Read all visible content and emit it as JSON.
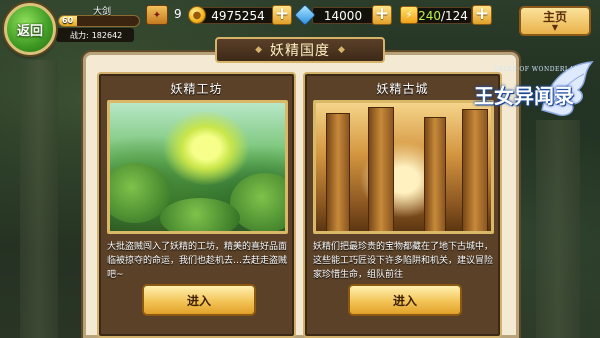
{
  "header": {
    "back_label": "返回",
    "player_name": "大剑",
    "level": "60",
    "power_label": "战力:",
    "power_value": "182642",
    "rank_value": "9",
    "gold": "4975254",
    "diamonds": "14000",
    "energy_current": "240",
    "energy_max": "/124",
    "main_menu_label": "主页",
    "level_progress": 0.22
  },
  "panel": {
    "title": "妖精国度",
    "cards": [
      {
        "title": "妖精工坊",
        "description": "大批盗贼闯入了妖精的工坊，精美的喜好品面临被掠夺的命运，我们也趁机去…去赶走盗贼吧~",
        "enter_label": "进入"
      },
      {
        "title": "妖精古城",
        "description": "妖精们把最珍贵的宝物都藏在了地下古城中，这些能工巧匠设下许多陷阱和机关，建议冒险家珍惜生命，组队前往",
        "enter_label": "进入"
      }
    ]
  },
  "logo": {
    "english": "TALES OF WONDERLAND",
    "chinese": "王女异闻录"
  },
  "colors": {
    "back_button": "#3e9a23",
    "accent_gold": "#e9b14a",
    "energy_text": "#b8f24a",
    "panel_bg": "#f4ead3",
    "card_bg": "#5a4128"
  }
}
